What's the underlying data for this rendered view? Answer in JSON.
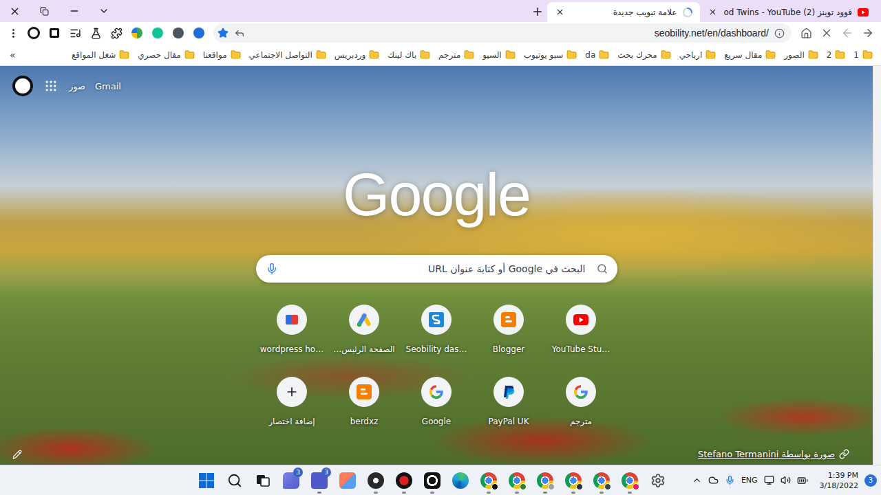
{
  "tabs": [
    {
      "label": "od Twins - YouTube (2) قوود توينز",
      "selected": false,
      "loading": false,
      "kind": "youtube"
    },
    {
      "label": "علامة تبويب جديدة",
      "selected": true,
      "loading": true,
      "kind": "newtab"
    }
  ],
  "address_bar": {
    "url": "seobility.net/en/dashboard/",
    "bookmarked": true
  },
  "bookmarks": {
    "folders": [
      "1",
      "2",
      "الصور",
      "مقال سريع",
      "ارباحي",
      "محرك بحث",
      "da",
      "سبو يوتيوب",
      "السيو",
      "مترجم",
      "باك لينك",
      "وردبريس",
      "التواصل الاجتماعي",
      "مواقعنا",
      "مقال حصري",
      "شغل المواقع"
    ],
    "overflow": "»"
  },
  "new_tab_page": {
    "header_links": [
      "صور",
      "Gmail"
    ],
    "logo": "Google",
    "search": {
      "placeholder": "البحث في Google أو كتابة عنوان URL"
    },
    "shortcuts": [
      {
        "label": "YouTube Stu…",
        "kind": "youtube",
        "color": "#ff0000"
      },
      {
        "label": "Blogger",
        "kind": "blogger",
        "color": "#f57d00"
      },
      {
        "label": "Seobility das…",
        "kind": "seobility",
        "color": "#1e88d6"
      },
      {
        "label": "الصفحة الرئيس…",
        "kind": "ads",
        "color": "#fbbc04"
      },
      {
        "label": "wordpress ho…",
        "kind": "wordpress",
        "color": "#2d6cdf"
      },
      {
        "label": "مترجم",
        "kind": "google",
        "color": "#4285f4"
      },
      {
        "label": "PayPal UK",
        "kind": "paypal",
        "color": "#003087"
      },
      {
        "label": "Google",
        "kind": "google",
        "color": "#4285f4"
      },
      {
        "label": "berdxz",
        "kind": "blogger",
        "color": "#f57d00"
      },
      {
        "label": "إضافة اختصار",
        "kind": "add",
        "color": "#202124"
      }
    ],
    "attribution": "صورة بواسطة Stefano Termanini"
  },
  "taskbar": {
    "apps": [
      {
        "kind": "start",
        "running": false
      },
      {
        "kind": "search",
        "running": false
      },
      {
        "kind": "taskview",
        "running": false
      },
      {
        "kind": "chat",
        "running": false,
        "badge": "3"
      },
      {
        "kind": "teams",
        "running": true,
        "badge": "3"
      },
      {
        "kind": "snip",
        "running": false
      },
      {
        "kind": "obs",
        "running": true
      },
      {
        "kind": "record",
        "running": true
      },
      {
        "kind": "camera",
        "running": true
      },
      {
        "kind": "edge",
        "running": false
      },
      {
        "kind": "chrome",
        "running": true,
        "color": "#111111"
      },
      {
        "kind": "chrome",
        "running": true,
        "color": "#2e7d32"
      },
      {
        "kind": "chrome",
        "running": true,
        "color": "#9e9e9e"
      },
      {
        "kind": "chrome",
        "running": true,
        "color": "#263238"
      },
      {
        "kind": "chrome",
        "running": true,
        "color": "#37474f"
      },
      {
        "kind": "chrome",
        "running": true,
        "color": "#e91e63"
      },
      {
        "kind": "settings",
        "running": false
      }
    ],
    "language": "ENG",
    "time": "1:39 PM",
    "date": "3/18/2022",
    "notifications": "3"
  }
}
